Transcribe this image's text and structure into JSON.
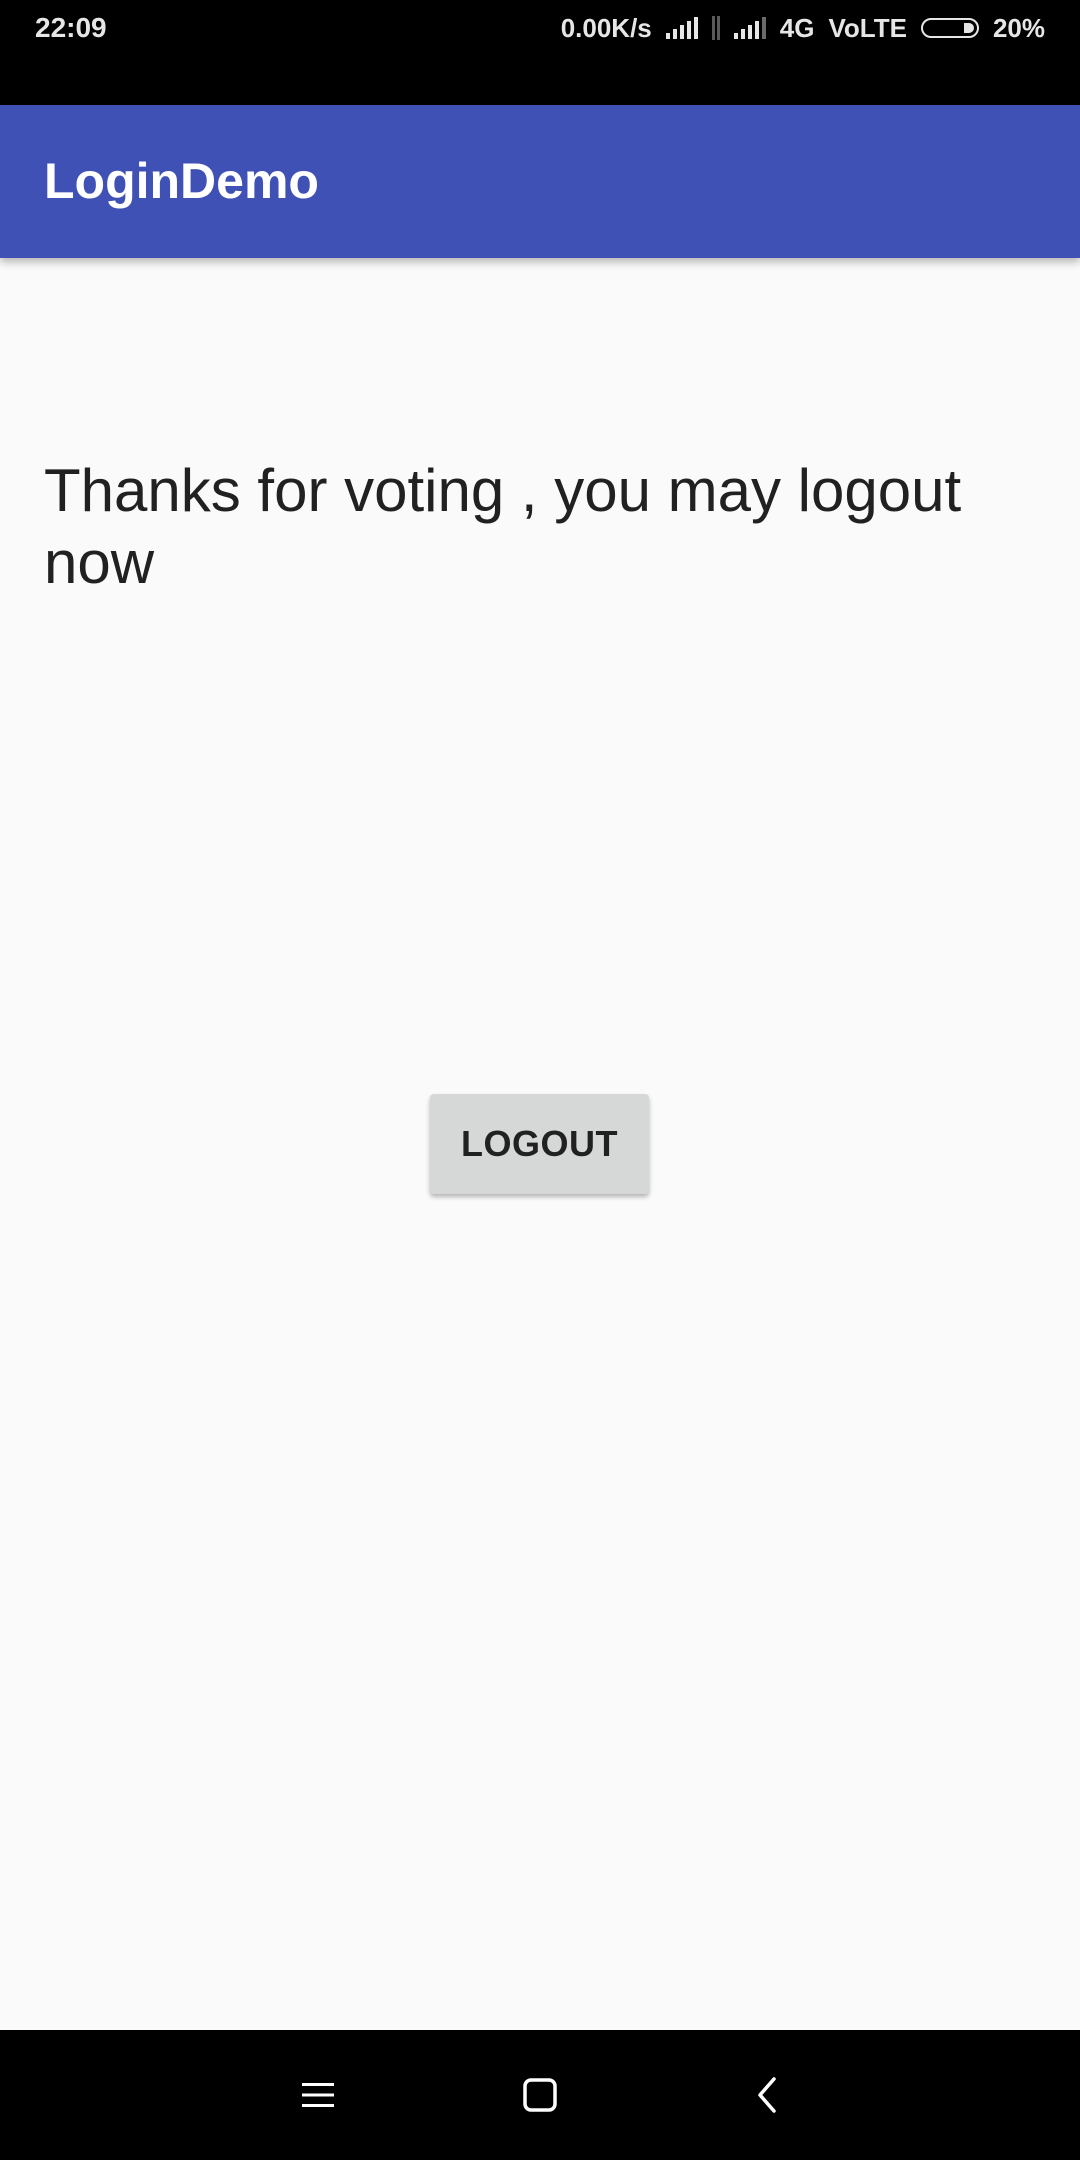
{
  "status_bar": {
    "time": "22:09",
    "network_speed": "0.00K/s",
    "network_type": "4G",
    "volte": "VoLTE",
    "battery": "20%",
    "icons": [
      "signal-icon",
      "data-transfer-icon",
      "signal-icon",
      "battery-icon"
    ]
  },
  "app_bar": {
    "title": "LoginDemo",
    "color": "#3f51b5"
  },
  "main": {
    "message": "Thanks for voting , you may logout now",
    "logout_label": "LOGOUT"
  },
  "nav_bar": {
    "icons": [
      "menu-icon",
      "home-icon",
      "back-icon"
    ]
  }
}
